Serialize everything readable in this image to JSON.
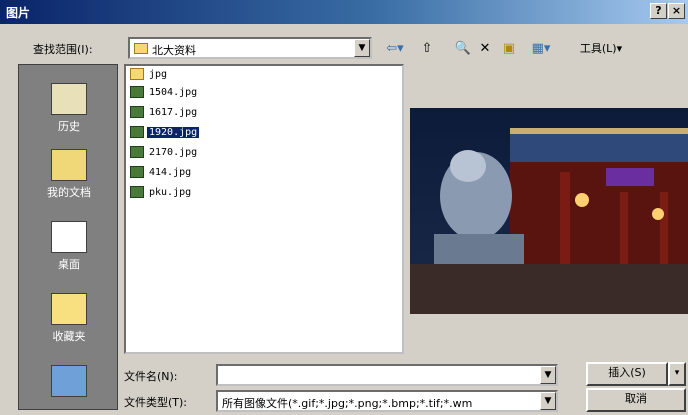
{
  "window": {
    "title": "图片",
    "help_glyph": "?",
    "close_glyph": "×"
  },
  "toolbar": {
    "look_in_label": "查找范围(I):",
    "look_in_value": "北大资料",
    "tools_label": "工具(L)▾"
  },
  "places": [
    {
      "label": "历史",
      "icon": "history-icon"
    },
    {
      "label": "我的文档",
      "icon": "my-documents-icon"
    },
    {
      "label": "桌面",
      "icon": "desktop-icon"
    },
    {
      "label": "收藏夹",
      "icon": "favorites-icon"
    },
    {
      "label": "",
      "icon": "network-icon"
    }
  ],
  "files": [
    {
      "name": "jpg",
      "type": "folder",
      "selected": false
    },
    {
      "name": "1504.jpg",
      "type": "jpg",
      "selected": false
    },
    {
      "name": "1617.jpg",
      "type": "jpg",
      "selected": false
    },
    {
      "name": "1920.jpg",
      "type": "jpg",
      "selected": true
    },
    {
      "name": "2170.jpg",
      "type": "jpg",
      "selected": false
    },
    {
      "name": "414.jpg",
      "type": "jpg",
      "selected": false
    },
    {
      "name": "pku.jpg",
      "type": "jpg",
      "selected": false
    }
  ],
  "form": {
    "filename_label": "文件名(N):",
    "filename_value": "",
    "filetype_label": "文件类型(T):",
    "filetype_value": "所有图像文件(*.gif;*.jpg;*.png;*.bmp;*.tif;*.wm"
  },
  "buttons": {
    "insert_label": "插入(S)",
    "insert_menu_glyph": "▾",
    "cancel_label": "取消"
  },
  "colors": {
    "titlebar_start": "#0a246a",
    "titlebar_end": "#a6caf0",
    "selection": "#0a246a",
    "dialog_face": "#d4d0c8"
  }
}
